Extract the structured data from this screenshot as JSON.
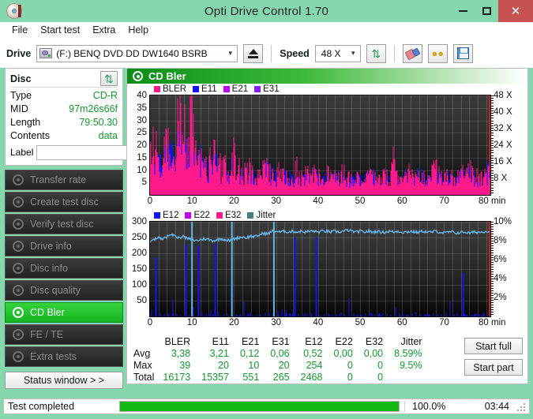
{
  "window": {
    "title": "Opti Drive Control 1.70",
    "app_icon": "disc-icon",
    "minimize": "–",
    "maximize": "□",
    "close": "✕"
  },
  "menu": {
    "items": [
      "File",
      "Start test",
      "Extra",
      "Help"
    ]
  },
  "toolbar": {
    "drive_label": "Drive",
    "drive_value": "(F:)   BENQ DVD DD DW1640 BSRB",
    "speed_label": "Speed",
    "speed_value": "48 X",
    "eject_icon": "eject-icon",
    "refresh_icon": "refresh-icon",
    "erase_icon": "eraser-icon",
    "coins_icon": "coins-icon",
    "save_icon": "floppy-save-icon"
  },
  "disc": {
    "heading": "Disc",
    "refresh_icon": "refresh-icon",
    "rows": [
      {
        "key": "Type",
        "value": "CD-R"
      },
      {
        "key": "MID",
        "value": "97m26s66f"
      },
      {
        "key": "Length",
        "value": "79:50.30"
      },
      {
        "key": "Contents",
        "value": "data"
      }
    ],
    "label_key": "Label",
    "label_value": "",
    "label_placeholder": "",
    "label_button_icon": "cd-icon"
  },
  "nav": {
    "items": [
      {
        "label": "Transfer rate",
        "active": false
      },
      {
        "label": "Create test disc",
        "active": false
      },
      {
        "label": "Verify test disc",
        "active": false
      },
      {
        "label": "Drive info",
        "active": false
      },
      {
        "label": "Disc info",
        "active": false
      },
      {
        "label": "Disc quality",
        "active": false
      },
      {
        "label": "CD Bler",
        "active": true
      },
      {
        "label": "FE / TE",
        "active": false
      },
      {
        "label": "Extra tests",
        "active": false
      }
    ],
    "status_window_button": "Status window > >"
  },
  "panel": {
    "title": "CD Bler",
    "icon": "disc-scan-icon"
  },
  "buttons": {
    "start_full": "Start full",
    "start_part": "Start part"
  },
  "statusbar": {
    "text": "Test completed",
    "progress_pct": "100.0%",
    "progress_value": 100,
    "elapsed": "03:44",
    "grip_icon": "resize-grip-icon"
  },
  "colors": {
    "bler": "#ff1a8c",
    "e11": "#1414ff",
    "e21": "#c000ff",
    "e31": "#8a1aff",
    "e12": "#1414ff",
    "e22": "#c000ff",
    "e32": "#ff1a8c",
    "jitter": "#4b7c7c",
    "speed_line": "#cc0000",
    "accent_green": "#15962f",
    "titlebar": "#86d6ae",
    "close_red": "#c75252"
  },
  "chart_data": [
    {
      "type": "line",
      "name": "bler-chart",
      "title": "CD Bler",
      "xlabel": "min",
      "ylabel": "",
      "xlim": [
        0,
        81
      ],
      "ylim": [
        0,
        40
      ],
      "xticks": [
        0,
        10,
        20,
        30,
        40,
        50,
        60,
        70,
        80
      ],
      "yticks": [
        5,
        10,
        15,
        20,
        25,
        30,
        35,
        40
      ],
      "y2ticks": [
        "8 X",
        "16 X",
        "24 X",
        "32 X",
        "40 X",
        "48 X"
      ],
      "y2lim": [
        0,
        52
      ],
      "grid": true,
      "legend": [
        {
          "label": "BLER",
          "color": "#ff1a8c"
        },
        {
          "label": "E11",
          "color": "#1414ff"
        },
        {
          "label": "E21",
          "color": "#c000ff"
        },
        {
          "label": "E31",
          "color": "#8a1aff"
        }
      ],
      "series": [
        {
          "name": "BLER",
          "color": "#ff1a8c",
          "values": [
            24,
            21,
            18,
            16,
            22,
            17,
            15,
            31,
            24,
            20,
            39,
            20,
            16,
            14,
            13,
            20,
            14,
            12,
            11,
            10,
            19,
            12,
            9,
            10,
            13,
            9,
            8,
            11,
            14,
            9,
            8,
            11,
            9,
            8,
            7,
            12,
            8,
            9,
            7,
            10,
            8,
            7,
            11,
            8,
            7,
            9,
            12,
            8,
            7,
            9,
            8,
            7,
            10,
            8,
            7,
            9,
            8,
            7,
            13,
            8,
            7,
            9,
            8,
            7,
            10,
            8,
            7,
            9,
            12,
            8,
            7,
            9,
            8,
            7,
            10,
            8,
            11,
            9,
            8,
            7,
            9
          ]
        },
        {
          "name": "E11",
          "color": "#1414ff",
          "values": [
            11,
            16,
            15,
            17,
            14,
            17,
            21,
            20,
            18,
            17,
            20,
            15,
            13,
            12,
            11,
            14,
            12,
            10,
            9,
            8,
            13,
            10,
            8,
            9,
            10,
            8,
            7,
            9,
            11,
            8,
            7,
            9,
            8,
            7,
            6,
            10,
            7,
            8,
            6,
            9,
            7,
            6,
            9,
            7,
            6,
            8,
            10,
            7,
            6,
            8,
            7,
            6,
            9,
            7,
            6,
            8,
            7,
            6,
            10,
            7,
            6,
            8,
            7,
            6,
            9,
            7,
            6,
            8,
            10,
            7,
            6,
            8,
            7,
            6,
            9,
            7,
            9,
            8,
            7,
            6,
            11
          ]
        }
      ]
    },
    {
      "type": "line",
      "name": "jitter-chart",
      "title": "Jitter / E12-E22-E32",
      "xlabel": "min",
      "ylabel": "",
      "xlim": [
        0,
        81
      ],
      "ylim": [
        0,
        300
      ],
      "xticks": [
        0,
        10,
        20,
        30,
        40,
        50,
        60,
        70,
        80
      ],
      "yticks": [
        50,
        100,
        150,
        200,
        250,
        300
      ],
      "y2ticks": [
        "2%",
        "4%",
        "6%",
        "8%",
        "10%"
      ],
      "y2lim": [
        0,
        10
      ],
      "grid": true,
      "legend": [
        {
          "label": "E12",
          "color": "#1414ff"
        },
        {
          "label": "E22",
          "color": "#c000ff"
        },
        {
          "label": "E32",
          "color": "#ff1a8c"
        },
        {
          "label": "Jitter",
          "color": "#4b7c7c"
        }
      ],
      "series": [
        {
          "name": "Jitter",
          "color": "#62b4ea",
          "unit": "%",
          "values": [
            7.9,
            8.1,
            8.3,
            8.2,
            8.4,
            8.6,
            8.5,
            8.3,
            8.4,
            8.2,
            8.1,
            8.0,
            8.1,
            8.2,
            8.1,
            8.0,
            8.1,
            8.2,
            8.1,
            8.0,
            8.2,
            8.3,
            8.4,
            8.3,
            8.5,
            8.4,
            8.6,
            8.8,
            8.7,
            9.0,
            9.0,
            8.9,
            9.0,
            8.9,
            9.0,
            8.9,
            9.0,
            8.9,
            9.0,
            9.0,
            8.9,
            9.0,
            9.0,
            8.9,
            9.0,
            8.9,
            9.0,
            9.1,
            9.0,
            8.9,
            9.0,
            8.9,
            9.0,
            8.9,
            9.0,
            8.9,
            8.9,
            9.0,
            8.9,
            9.0,
            8.9,
            8.9,
            9.0,
            8.9,
            8.9,
            9.0,
            8.9,
            8.9,
            9.0,
            8.9,
            8.8,
            8.9,
            8.9,
            8.8,
            8.9,
            8.9,
            8.8,
            8.9,
            8.9,
            8.9,
            9.0
          ]
        },
        {
          "name": "E12",
          "color": "#1414ff",
          "values": [
            20,
            188,
            10,
            8,
            12,
            55,
            8,
            6,
            230,
            6,
            30,
            225,
            12,
            8,
            20,
            230,
            15,
            6,
            10,
            118,
            8,
            5,
            46,
            6,
            4,
            6,
            8,
            6,
            12,
            10,
            18,
            22,
            20,
            8,
            250,
            8,
            6,
            10,
            12,
            250,
            6,
            8,
            10,
            6,
            8,
            12,
            6,
            58,
            10,
            8,
            6,
            10,
            12,
            8,
            6,
            10,
            8,
            6,
            30,
            12,
            8,
            6,
            10,
            12,
            8,
            6,
            8,
            10,
            6,
            8,
            12,
            50,
            8,
            6,
            138,
            8,
            6,
            10,
            8,
            12,
            8
          ]
        }
      ]
    }
  ],
  "stats": {
    "columns": [
      "BLER",
      "E11",
      "E21",
      "E31",
      "E12",
      "E22",
      "E32",
      "Jitter"
    ],
    "rows": [
      {
        "label": "Avg",
        "values": [
          "3,38",
          "3,21",
          "0,12",
          "0,06",
          "0,52",
          "0,00",
          "0,00",
          "8.59%"
        ]
      },
      {
        "label": "Max",
        "values": [
          "39",
          "20",
          "10",
          "20",
          "254",
          "0",
          "0",
          "9.5%"
        ]
      },
      {
        "label": "Total",
        "values": [
          "16173",
          "15357",
          "551",
          "265",
          "2468",
          "0",
          "0",
          ""
        ]
      }
    ]
  }
}
